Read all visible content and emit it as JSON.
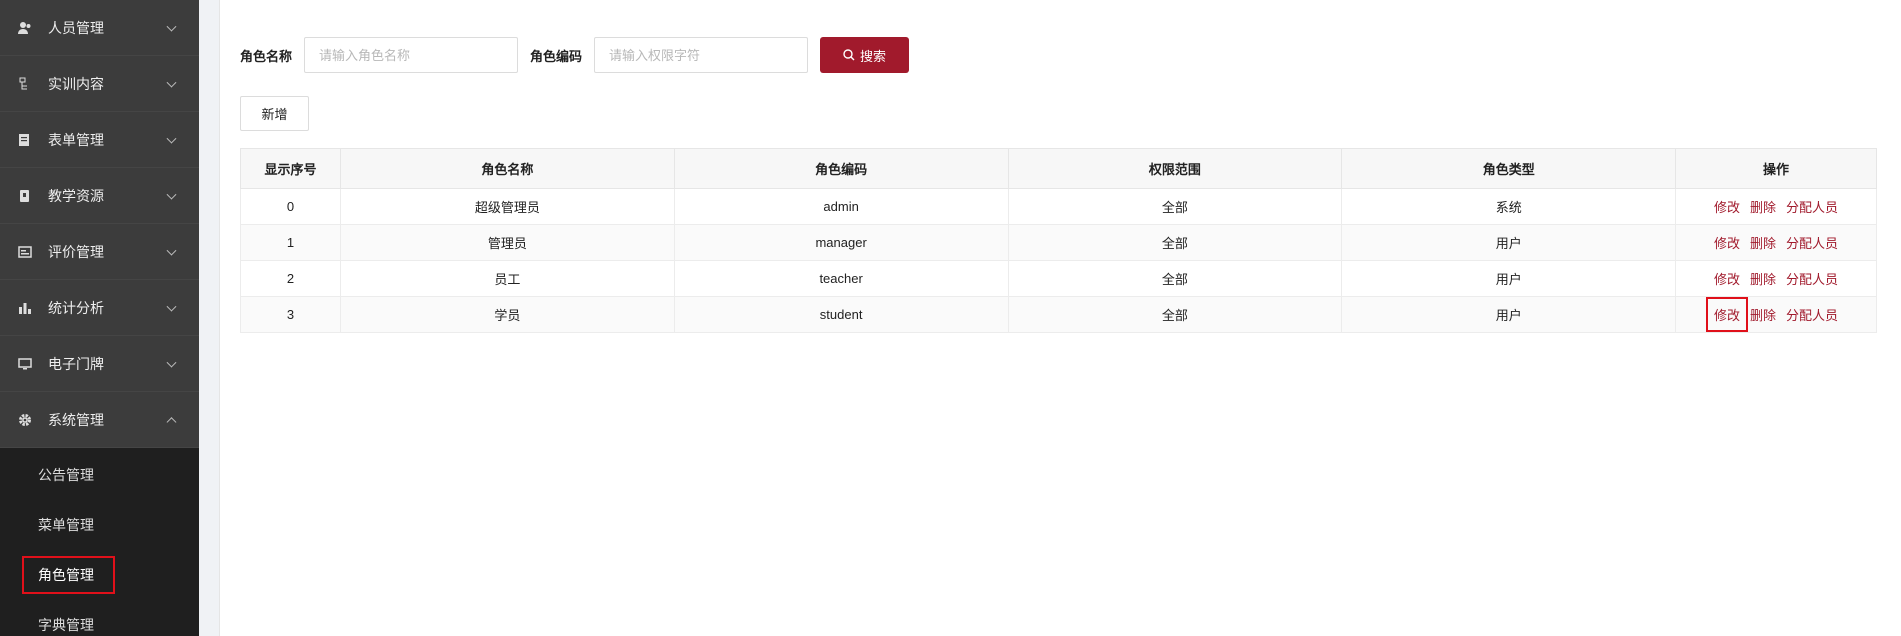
{
  "sidebar": {
    "items": [
      {
        "label": "人员管理",
        "icon": "users-icon"
      },
      {
        "label": "实训内容",
        "icon": "tree-icon"
      },
      {
        "label": "表单管理",
        "icon": "form-icon"
      },
      {
        "label": "教学资源",
        "icon": "book-icon"
      },
      {
        "label": "评价管理",
        "icon": "rating-icon"
      },
      {
        "label": "统计分析",
        "icon": "bar-chart-icon"
      },
      {
        "label": "电子门牌",
        "icon": "monitor-icon"
      },
      {
        "label": "系统管理",
        "icon": "gear-icon"
      }
    ],
    "submenu": [
      {
        "label": "公告管理"
      },
      {
        "label": "菜单管理"
      },
      {
        "label": "角色管理",
        "active": true
      },
      {
        "label": "字典管理"
      }
    ]
  },
  "search": {
    "name_label": "角色名称",
    "name_placeholder": "请输入角色名称",
    "code_label": "角色编码",
    "code_placeholder": "请输入权限字符",
    "button_label": "搜索"
  },
  "toolbar": {
    "add_label": "新增"
  },
  "table": {
    "headers": [
      "显示序号",
      "角色名称",
      "角色编码",
      "权限范围",
      "角色类型",
      "操作"
    ],
    "rows": [
      {
        "idx": "0",
        "name": "超级管理员",
        "code": "admin",
        "scope": "全部",
        "type": "系统"
      },
      {
        "idx": "1",
        "name": "管理员",
        "code": "manager",
        "scope": "全部",
        "type": "用户"
      },
      {
        "idx": "2",
        "name": "员工",
        "code": "teacher",
        "scope": "全部",
        "type": "用户"
      },
      {
        "idx": "3",
        "name": "学员",
        "code": "student",
        "scope": "全部",
        "type": "用户"
      }
    ],
    "ops": {
      "edit": "修改",
      "delete": "删除",
      "assign": "分配人员"
    }
  },
  "colors": {
    "accent": "#a11a2c",
    "highlight": "#e0101a",
    "sidebar_bg": "#3c3c3c"
  }
}
